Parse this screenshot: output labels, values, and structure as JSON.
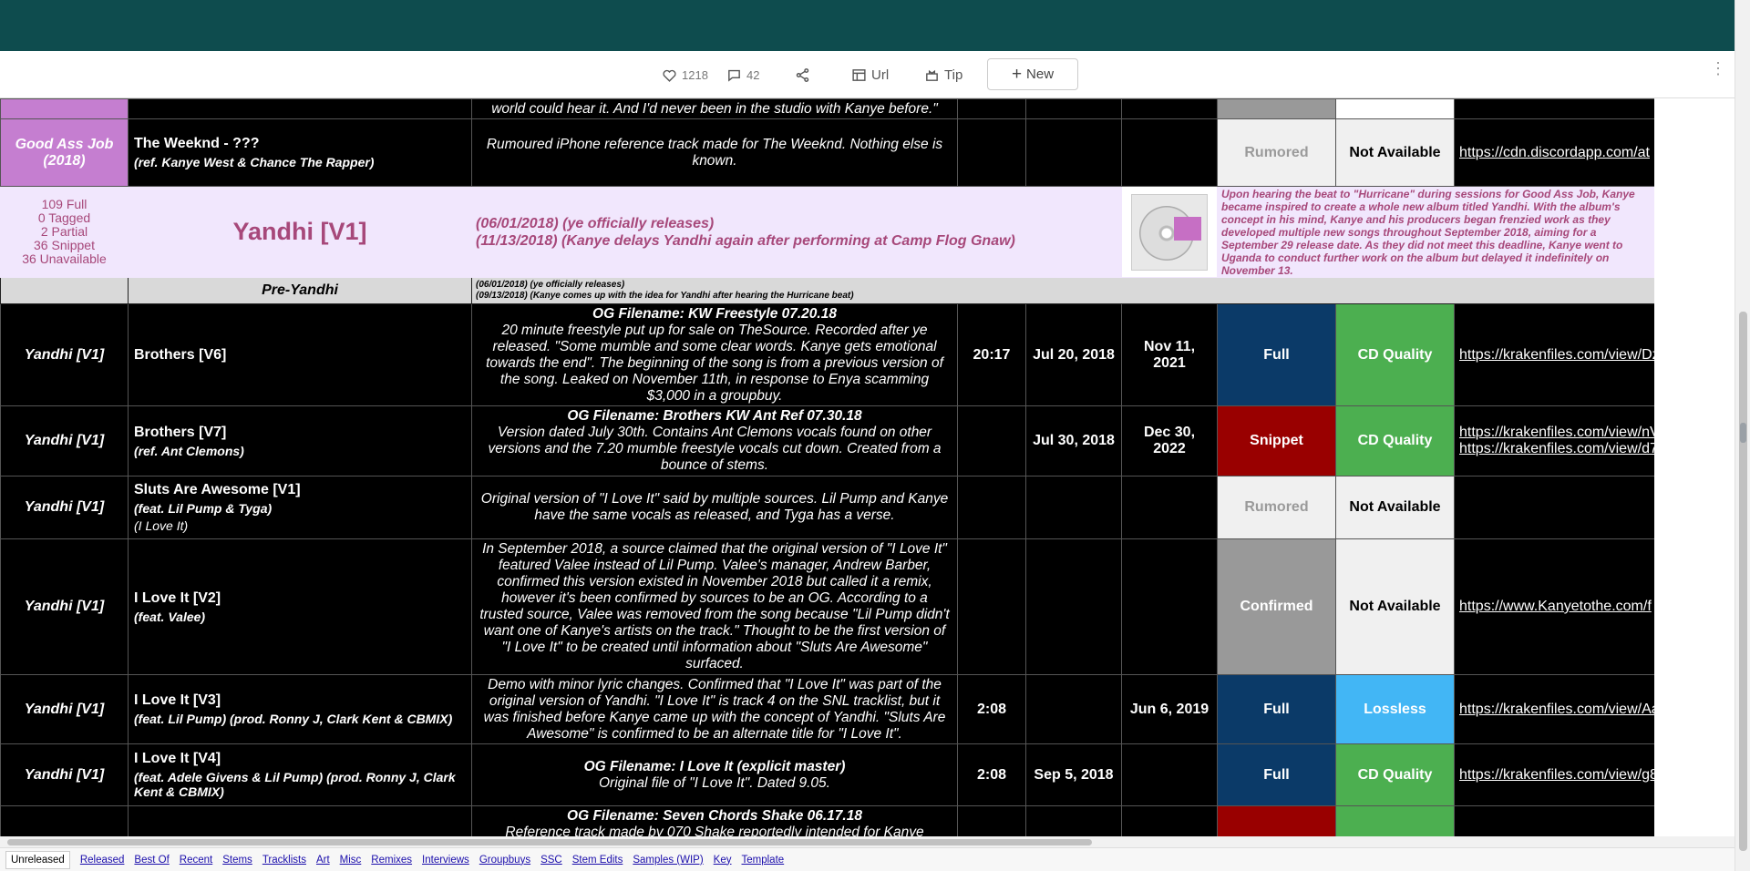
{
  "toolbar": {
    "likes": "1218",
    "comments": "42",
    "url_label": "Url",
    "tip_label": "Tip",
    "new_label": "New"
  },
  "partial_row": {
    "notes_tail": "world could hear it. And I'd never been in the studio with Kanye before.\""
  },
  "gaj_row": {
    "era": "Good Ass Job (2018)",
    "name": "The Weeknd - ???",
    "sub": "(ref. Kanye West & Chance The Rapper)",
    "notes": "Rumoured iPhone reference track made for The Weeknd. Nothing else is known.",
    "status": "Rumored",
    "quality": "Not Available",
    "link": "https://cdn.discordapp.com/at"
  },
  "era_header": {
    "stats": [
      "109 Full",
      "0 Tagged",
      "2 Partial",
      "36 Snippet",
      "36 Unavailable"
    ],
    "title": "Yandhi [V1]",
    "date1": "(06/01/2018) (ye officially releases)",
    "date2": "(11/13/2018) (Kanye delays Yandhi again after performing at Camp Flog Gnaw)",
    "description": "Upon hearing the beat to \"Hurricane\" during sessions for Good Ass Job, Kanye became inspired to create a whole new album titled Yandhi. With the album's concept in his mind, Kanye and his producers began frenzied work as they developed multiple new songs throughout September 2018, aiming for a September 29 release date. As they did not meet this deadline, Kanye went to Uganda to conduct further work on the album but delayed it indefinitely on November 13."
  },
  "subera": {
    "title": "Pre-Yandhi",
    "date1": "(06/01/2018) (ye officially releases)",
    "date2": "(09/13/2018) (Kanye comes up with the idea for Yandhi after hearing the Hurricane beat)"
  },
  "rows": [
    {
      "era": "Yandhi [V1]",
      "name": "Brothers [V6]",
      "sub": "",
      "sub2": "",
      "og": "OG Filename: KW Freestyle 07.20.18",
      "notes": "20 minute freestyle put up for sale on TheSource. Recorded after ye released. \"Some mumble and some clear words. Kanye gets emotional towards the end\". The beginning of the song is from a previous version of the song. Leaked on November 11th, in response to Enya scamming $3,000 in a groupbuy.",
      "length": "20:17",
      "file_date": "Jul 20, 2018",
      "leak_date": "Nov 11, 2021",
      "status": "Full",
      "quality": "CD Quality",
      "links": [
        "https://krakenfiles.com/view/Dz"
      ]
    },
    {
      "era": "Yandhi [V1]",
      "name": "Brothers [V7]",
      "sub": "(ref. Ant Clemons)",
      "sub2": "",
      "og": "OG Filename: Brothers KW Ant Ref 07.30.18",
      "notes": "Version dated July 30th. Contains Ant Clemons vocals found on other versions and the 7.20 mumble freestyle vocals cut down. Created from a bounce of stems.",
      "length": "",
      "file_date": "Jul 30, 2018",
      "leak_date": "Dec 30, 2022",
      "status": "Snippet",
      "quality": "CD Quality",
      "links": [
        "https://krakenfiles.com/view/nV",
        "https://krakenfiles.com/view/d7"
      ]
    },
    {
      "era": "Yandhi [V1]",
      "name": "Sluts Are Awesome [V1]",
      "sub": "(feat. Lil Pump & Tyga)",
      "sub2": "(I Love It)",
      "og": "",
      "notes": "Original version of \"I Love It\" said by multiple sources. Lil Pump and Kanye have the same vocals as released, and Tyga has a verse.",
      "length": "",
      "file_date": "",
      "leak_date": "",
      "status": "Rumored",
      "quality": "Not Available",
      "links": []
    },
    {
      "era": "Yandhi [V1]",
      "name": "I Love It [V2]",
      "sub": "(feat. Valee)",
      "sub2": "",
      "og": "",
      "notes": "In September 2018, a source claimed that the original version of \"I Love It\" featured Valee instead of Lil Pump. Valee's manager, Andrew Barber, confirmed this version existed in November 2018 but called it a remix, however it's been confirmed by sources to be an OG. According to a trusted source, Valee was removed from the song because \"Lil Pump didn't want one of Kanye's artists on the track.\" Thought to be the first version of \"I Love It\" to be created until information about \"Sluts Are Awesome\" surfaced.",
      "length": "",
      "file_date": "",
      "leak_date": "",
      "status": "Confirmed",
      "quality": "Not Available",
      "links": [
        "https://www.Kanyetothe.com/f"
      ]
    },
    {
      "era": "Yandhi [V1]",
      "name": "I Love It [V3]",
      "sub": "(feat. Lil Pump) (prod. Ronny J, Clark Kent & CBMIX)",
      "sub2": "",
      "og": "",
      "notes": "Demo with minor lyric changes. Confirmed that \"I Love It\" was part of the original version of Yandhi. \"I Love It\" is track 4 on the SNL tracklist, but it was finished before Kanye came up with the concept of Yandhi. \"Sluts Are Awesome\" is confirmed to be an alternate title for \"I Love It\".",
      "length": "2:08",
      "file_date": "",
      "leak_date": "Jun 6, 2019",
      "status": "Full",
      "quality": "Lossless",
      "links": [
        "https://krakenfiles.com/view/Aa"
      ]
    },
    {
      "era": "Yandhi [V1]",
      "name": "I Love It [V4]",
      "sub": "(feat. Adele Givens & Lil Pump) (prod. Ronny J, Clark Kent & CBMIX)",
      "sub2": "",
      "og": "OG Filename: I Love It (explicit master)",
      "notes": "Original file of \"I Love It\". Dated 9.05.",
      "length": "2:08",
      "file_date": "Sep 5, 2018",
      "leak_date": "",
      "status": "Full",
      "quality": "CD Quality",
      "links": [
        "https://krakenfiles.com/view/g8"
      ]
    }
  ],
  "cut_row": {
    "og": "OG Filename: Seven Chords Shake 06.17.18",
    "notes": "Reference track made by 070 Shake reportedly intended for Kanye"
  },
  "tabs": [
    "Unreleased",
    "Released",
    "Best Of",
    "Recent",
    "Stems",
    "Tracklists",
    "Art",
    "Misc",
    "Remixes",
    "Interviews",
    "Groupbuys",
    "SSC",
    "Stem Edits",
    "Samples (WIP)",
    "Key",
    "Template"
  ],
  "active_tab": "Unreleased"
}
